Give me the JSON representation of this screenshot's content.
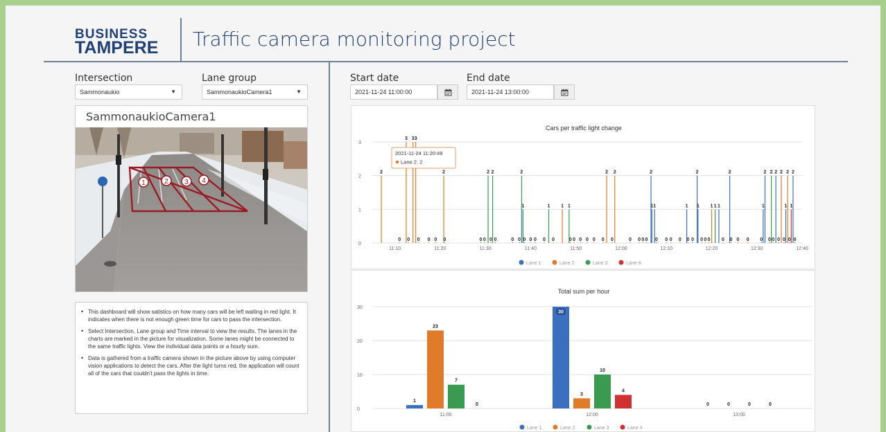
{
  "header": {
    "logo_line1": "BUSINESS",
    "logo_line2": "TAMPERE",
    "title": "Traffic camera monitoring project"
  },
  "filters": {
    "intersection_label": "Intersection",
    "intersection_value": "Sammonaukio",
    "lane_group_label": "Lane group",
    "lane_group_value": "SammonaukioCamera1",
    "start_date_label": "Start date",
    "start_date_value": "2021-11-24 11:00:00",
    "end_date_label": "End date",
    "end_date_value": "2021-11-24 13:00:00"
  },
  "camera": {
    "title": "SammonaukioCamera1",
    "lane_markers": [
      "1",
      "2",
      "3",
      "4"
    ]
  },
  "info": {
    "paragraphs": [
      "This dashboard will show satistics on how many cars will be left waiting in red light. It indicates when there is not enough green time for cars to pass the intersection.",
      "Select Intersection, Lane group and Time interval to view the results. The lanes in the charts are marked in the picture for visualization. Some lanes might be connected to the same traffic lights. View the individual data points or a hourly sum.",
      "Data is gathered from a traffic camera shown in the picture above by using computer vision applications to detect the cars. After the light turns red, the application will count all of the cars that couldn't pass the lights in time."
    ]
  },
  "colors": {
    "lane1": "#3b6fbf",
    "lane2": "#e07b2a",
    "lane3": "#3a9a4f",
    "lane4": "#d03131",
    "brand": "#1f3f77"
  },
  "icons": {
    "calendar": "calendar-icon",
    "dropdown": "caret-down-icon"
  },
  "chart_data": [
    {
      "type": "bar",
      "title": "Cars per traffic light change",
      "xlabel": "",
      "ylabel": "",
      "ylim": [
        0,
        3
      ],
      "yticks": [
        "0",
        "1",
        "2",
        "3"
      ],
      "xticks": [
        "11:10",
        "11:20",
        "11:30",
        "11:40",
        "11:50",
        "12:00",
        "12:10",
        "12:20",
        "12:30",
        "12:40"
      ],
      "xlim_minutes_after_11": [
        5,
        100
      ],
      "legend": [
        "Lane 1",
        "Lane 2",
        "Lane 3",
        "Lane 4"
      ],
      "legend_position": "bottom",
      "grid": true,
      "tooltip": {
        "time": "2021-11-24 11:20:49",
        "lane": "Lane 2",
        "value": "2",
        "label": "Lane 2: 2"
      },
      "points": [
        {
          "m": 7.0,
          "lane": 2,
          "v": 2
        },
        {
          "m": 11.0,
          "lane": 2,
          "v": 0
        },
        {
          "m": 12.5,
          "lane": 2,
          "v": 3
        },
        {
          "m": 13.0,
          "lane": 2,
          "v": 0
        },
        {
          "m": 14.0,
          "lane": 2,
          "v": 3
        },
        {
          "m": 14.6,
          "lane": 2,
          "v": 3
        },
        {
          "m": 15.2,
          "lane": 2,
          "v": 0
        },
        {
          "m": 17.5,
          "lane": 2,
          "v": 0
        },
        {
          "m": 19.0,
          "lane": 2,
          "v": 0
        },
        {
          "m": 20.8,
          "lane": 2,
          "v": 2
        },
        {
          "m": 21.0,
          "lane": 2,
          "v": 0
        },
        {
          "m": 29.0,
          "lane": 3,
          "v": 0
        },
        {
          "m": 29.8,
          "lane": 3,
          "v": 0
        },
        {
          "m": 30.6,
          "lane": 3,
          "v": 2
        },
        {
          "m": 31.2,
          "lane": 3,
          "v": 0
        },
        {
          "m": 31.6,
          "lane": 3,
          "v": 2
        },
        {
          "m": 32.2,
          "lane": 3,
          "v": 0
        },
        {
          "m": 36.0,
          "lane": 1,
          "v": 0
        },
        {
          "m": 37.5,
          "lane": 1,
          "v": 0
        },
        {
          "m": 38.0,
          "lane": 3,
          "v": 2
        },
        {
          "m": 38.3,
          "lane": 1,
          "v": 1
        },
        {
          "m": 38.6,
          "lane": 1,
          "v": 0
        },
        {
          "m": 40.0,
          "lane": 2,
          "v": 0
        },
        {
          "m": 41.0,
          "lane": 3,
          "v": 0
        },
        {
          "m": 43.0,
          "lane": 2,
          "v": 0
        },
        {
          "m": 44.0,
          "lane": 3,
          "v": 1
        },
        {
          "m": 45.0,
          "lane": 2,
          "v": 0
        },
        {
          "m": 47.0,
          "lane": 2,
          "v": 1
        },
        {
          "m": 48.5,
          "lane": 3,
          "v": 1
        },
        {
          "m": 48.8,
          "lane": 2,
          "v": 0
        },
        {
          "m": 49.6,
          "lane": 2,
          "v": 0
        },
        {
          "m": 51.0,
          "lane": 2,
          "v": 0
        },
        {
          "m": 52.5,
          "lane": 2,
          "v": 0
        },
        {
          "m": 54.0,
          "lane": 2,
          "v": 0
        },
        {
          "m": 56.0,
          "lane": 2,
          "v": 0
        },
        {
          "m": 56.8,
          "lane": 2,
          "v": 2
        },
        {
          "m": 58.0,
          "lane": 3,
          "v": 0
        },
        {
          "m": 58.6,
          "lane": 2,
          "v": 2
        },
        {
          "m": 62.0,
          "lane": 2,
          "v": 0
        },
        {
          "m": 64.0,
          "lane": 2,
          "v": 0
        },
        {
          "m": 64.8,
          "lane": 2,
          "v": 0
        },
        {
          "m": 65.6,
          "lane": 2,
          "v": 0
        },
        {
          "m": 66.6,
          "lane": 1,
          "v": 2
        },
        {
          "m": 66.8,
          "lane": 1,
          "v": 1
        },
        {
          "m": 67.4,
          "lane": 1,
          "v": 1
        },
        {
          "m": 67.8,
          "lane": 1,
          "v": 0
        },
        {
          "m": 70.0,
          "lane": 2,
          "v": 0
        },
        {
          "m": 71.0,
          "lane": 2,
          "v": 0
        },
        {
          "m": 73.0,
          "lane": 2,
          "v": 0
        },
        {
          "m": 74.5,
          "lane": 1,
          "v": 1
        },
        {
          "m": 74.8,
          "lane": 2,
          "v": 0
        },
        {
          "m": 75.8,
          "lane": 1,
          "v": 0
        },
        {
          "m": 76.8,
          "lane": 1,
          "v": 2
        },
        {
          "m": 77.0,
          "lane": 1,
          "v": 1
        },
        {
          "m": 77.8,
          "lane": 2,
          "v": 0
        },
        {
          "m": 78.6,
          "lane": 2,
          "v": 0
        },
        {
          "m": 79.4,
          "lane": 2,
          "v": 0
        },
        {
          "m": 80.0,
          "lane": 2,
          "v": 1
        },
        {
          "m": 80.8,
          "lane": 3,
          "v": 1
        },
        {
          "m": 81.6,
          "lane": 1,
          "v": 1
        },
        {
          "m": 82.5,
          "lane": 2,
          "v": 0
        },
        {
          "m": 84.0,
          "lane": 1,
          "v": 2
        },
        {
          "m": 84.3,
          "lane": 2,
          "v": 0
        },
        {
          "m": 85.8,
          "lane": 2,
          "v": 0
        },
        {
          "m": 88.0,
          "lane": 2,
          "v": 0
        },
        {
          "m": 91.0,
          "lane": 3,
          "v": 0
        },
        {
          "m": 91.4,
          "lane": 1,
          "v": 1
        },
        {
          "m": 91.8,
          "lane": 1,
          "v": 2
        },
        {
          "m": 92.8,
          "lane": 4,
          "v": 0
        },
        {
          "m": 93.2,
          "lane": 3,
          "v": 2
        },
        {
          "m": 93.6,
          "lane": 2,
          "v": 0
        },
        {
          "m": 94.2,
          "lane": 1,
          "v": 2
        },
        {
          "m": 94.8,
          "lane": 3,
          "v": 0
        },
        {
          "m": 95.4,
          "lane": 2,
          "v": 2
        },
        {
          "m": 96.0,
          "lane": 4,
          "v": 0
        },
        {
          "m": 96.4,
          "lane": 1,
          "v": 1
        },
        {
          "m": 96.8,
          "lane": 2,
          "v": 2
        },
        {
          "m": 97.2,
          "lane": 3,
          "v": 0
        },
        {
          "m": 97.6,
          "lane": 4,
          "v": 1
        },
        {
          "m": 98.0,
          "lane": 1,
          "v": 2
        },
        {
          "m": 98.4,
          "lane": 1,
          "v": 0
        }
      ]
    },
    {
      "type": "bar",
      "title": "Total sum per hour",
      "categories": [
        "11:00",
        "12:00",
        "13:00"
      ],
      "series": [
        {
          "name": "Lane 1",
          "values": [
            1,
            30,
            0
          ]
        },
        {
          "name": "Lane 2",
          "values": [
            23,
            3,
            0
          ]
        },
        {
          "name": "Lane 3",
          "values": [
            7,
            10,
            0
          ]
        },
        {
          "name": "Lane 4",
          "values": [
            0,
            4,
            0
          ]
        }
      ],
      "xlabel": "",
      "ylabel": "",
      "ylim": [
        0,
        30
      ],
      "yticks": [
        "0",
        "10",
        "20",
        "30"
      ],
      "legend_position": "bottom",
      "grid": true
    }
  ]
}
